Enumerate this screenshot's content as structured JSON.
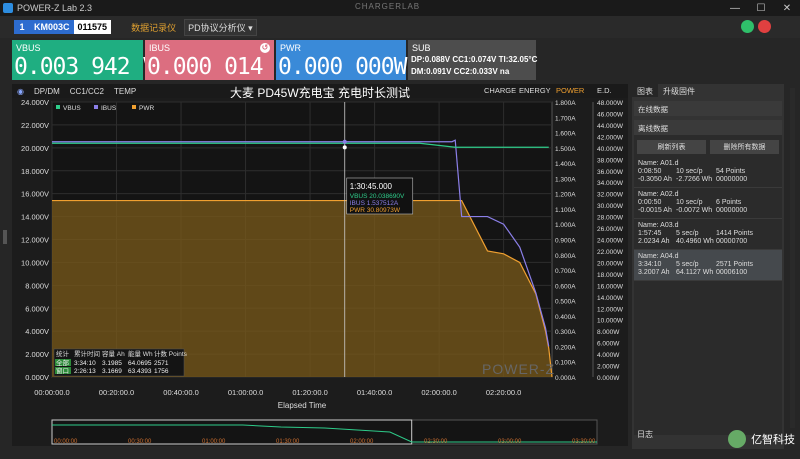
{
  "window": {
    "title": "POWER-Z Lab 2.3",
    "brand": "CHARGERLAB"
  },
  "toolbar": {
    "device_num": "1",
    "device_name": "KM003C",
    "device_serial": "011575",
    "record_link": "数据记录仪",
    "protocol_dropdown": "PD协议分析仪 ▾"
  },
  "meters": {
    "vbus": {
      "label": "VBUS",
      "value": "0.003 942 V"
    },
    "ibus": {
      "label": "IBUS",
      "value": "0.000 014 A"
    },
    "pwr": {
      "label": "PWR",
      "value": "0.000 000W"
    },
    "sub": {
      "label": "SUB",
      "line1": "DP:0.088V  CC1:0.074V  TI:32.05°C",
      "line2": "DM:0.091V  CC2:0.033V  na"
    }
  },
  "chart_bar": {
    "dp_dm": "DP/DM",
    "cc": "CC1/CC2",
    "temp": "TEMP",
    "title": "大麦 PD45W充电宝 充电时长测试",
    "tabs": [
      "CHARGE",
      "ENERGY",
      "POWER",
      "E.D."
    ],
    "active_tab": "POWER"
  },
  "chart_data": {
    "type": "line",
    "title": "大麦 PD45W充电宝 充电时长测试",
    "xlabel": "Elapsed Time",
    "x_ticks": [
      "00:00:00.0",
      "00:20:00.0",
      "00:40:00.0",
      "01:00:00.0",
      "01:20:00.0",
      "01:40:00.0",
      "02:00:00.0",
      "02:20:00.0"
    ],
    "y_left_ticks": [
      "0.000V",
      "2.000V",
      "4.000V",
      "6.000V",
      "8.000V",
      "10.000V",
      "12.000V",
      "14.000V",
      "16.000V",
      "18.000V",
      "20.000V",
      "22.000V",
      "24.000V"
    ],
    "y_mid_ticks": [
      "0.000A",
      "0.100A",
      "0.200A",
      "0.300A",
      "0.400A",
      "0.500A",
      "0.600A",
      "0.700A",
      "0.800A",
      "0.900A",
      "1.000A",
      "1.100A",
      "1.200A",
      "1.300A",
      "1.400A",
      "1.500A",
      "1.600A",
      "1.700A",
      "1.800A"
    ],
    "y_right_ticks": [
      "0.000W",
      "2.000W",
      "4.000W",
      "6.000W",
      "8.000W",
      "10.000W",
      "12.000W",
      "14.000W",
      "16.000W",
      "18.000W",
      "20.000W",
      "22.000W",
      "24.000W",
      "26.000W",
      "28.000W",
      "30.000W",
      "32.000W",
      "34.000W",
      "36.000W",
      "38.000W",
      "40.000W",
      "42.000W",
      "44.000W",
      "46.000W",
      "48.000W"
    ],
    "legend": [
      "VBUS",
      "IBUS",
      "PWR"
    ],
    "colors": {
      "vbus": "#2ecc8a",
      "ibus": "#8b7fe8",
      "pwr": "#f0a030"
    },
    "series": [
      {
        "name": "VBUS",
        "unit": "V",
        "x_min": [
          0,
          114,
          125,
          130,
          154
        ],
        "values": [
          20.4,
          20.4,
          20.05,
          20.05,
          20.05
        ]
      },
      {
        "name": "IBUS",
        "unit": "A",
        "x_min": [
          0,
          114,
          115,
          125,
          127,
          135,
          145,
          150,
          154,
          155
        ],
        "values": [
          1.54,
          1.54,
          1.55,
          1.55,
          0.0,
          0.0,
          0.0,
          0.0,
          0.0,
          0.0
        ]
      },
      {
        "name": "PWR",
        "unit": "W",
        "x_min": [
          0,
          124,
          125,
          127,
          135,
          140,
          145,
          150,
          153,
          154,
          155
        ],
        "values": [
          30.8,
          30.8,
          30.8,
          30.8,
          22.0,
          21.5,
          20.0,
          14.5,
          8.0,
          5.0,
          0.0
        ]
      }
    ],
    "cursor": {
      "time": "1:30:45.000",
      "vbus": "VBUS  20.038690V",
      "ibus": "IBUS  1.537512A",
      "pwr": "PWR  30.80973W"
    },
    "summary": {
      "headers": [
        "统计",
        "累计时间",
        "容量 Ah",
        "能量 Wh",
        "计数 Points"
      ],
      "rows": [
        [
          "全部",
          "3:34:10",
          "3.1985",
          "64.0695",
          "2571"
        ],
        [
          "窗口",
          "2:26:13",
          "3.1669",
          "63.4393",
          "1756"
        ]
      ]
    },
    "watermark": "POWER-Z",
    "overview_ticks": [
      "00:00:00",
      "00:30:00",
      "01:00:00",
      "01:30:00",
      "02:00:00",
      "02:30:00",
      "03:00:00",
      "03:30:00"
    ]
  },
  "side": {
    "tabs": [
      "图表",
      "升级固件"
    ],
    "online": "在线数据",
    "offline": "离线数据",
    "refresh": "刷新列表",
    "delete_all": "删除所有数据",
    "records": [
      {
        "name": "Name: A01.d",
        "t": "0:08:50",
        "rate": "10 sec/p",
        "pts": "54 Points",
        "ah": "-0.3050 Ah",
        "wh": "-2.7266 Wh",
        "id": "00000000"
      },
      {
        "name": "Name: A02.d",
        "t": "0:00:50",
        "rate": "10 sec/p",
        "pts": "6 Points",
        "ah": "-0.0015 Ah",
        "wh": "-0.0072 Wh",
        "id": "00000000"
      },
      {
        "name": "Name: A03.d",
        "t": "1:57:45",
        "rate": "5 sec/p",
        "pts": "1414 Points",
        "ah": "2.0234 Ah",
        "wh": "40.4960 Wh",
        "id": "00000700"
      },
      {
        "name": "Name: A04.d",
        "t": "3:34:10",
        "rate": "5 sec/p",
        "pts": "2571 Points",
        "ah": "3.2007 Ah",
        "wh": "64.1127 Wh",
        "id": "00006100"
      }
    ],
    "log": "日志"
  },
  "site_watermark": "亿智科技"
}
